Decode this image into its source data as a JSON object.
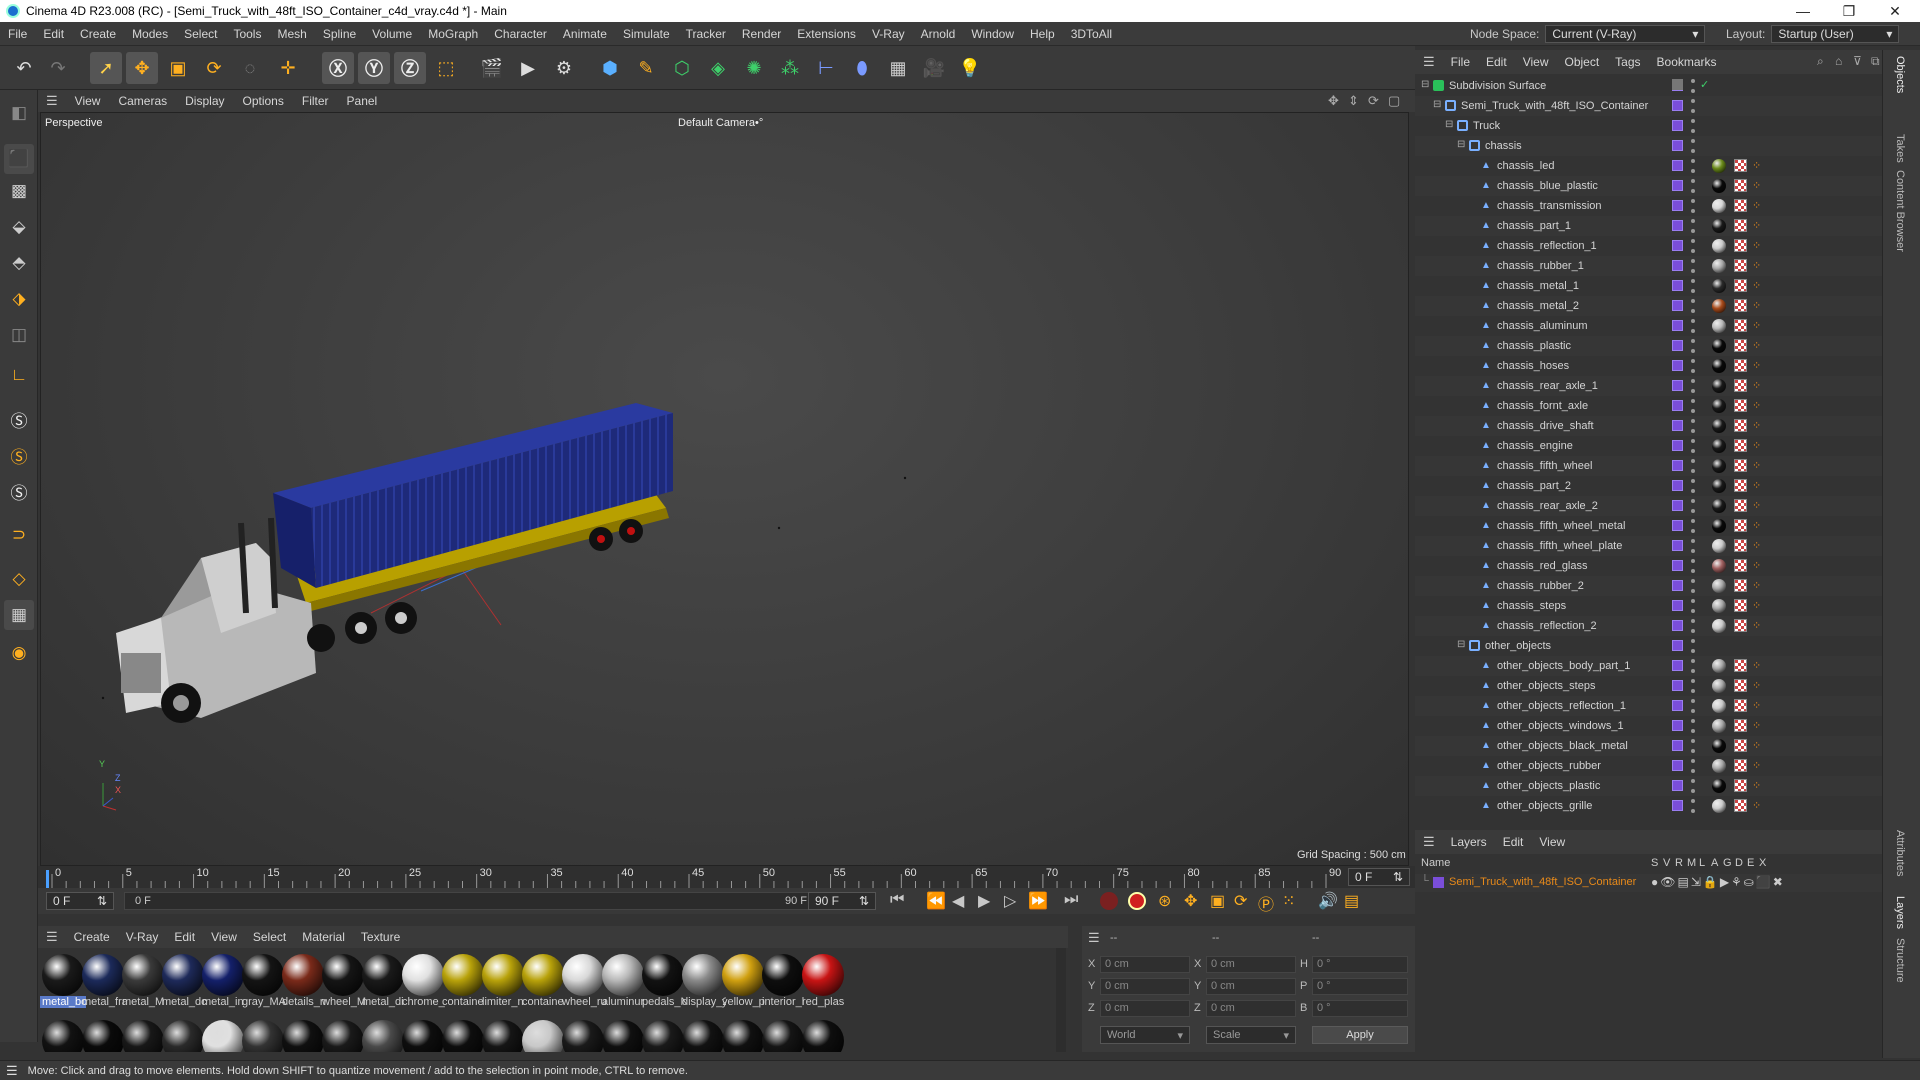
{
  "window": {
    "title": "Cinema 4D R23.008 (RC) - [Semi_Truck_with_48ft_ISO_Container_c4d_vray.c4d *] - Main",
    "controls": [
      "—",
      "❐",
      "✕"
    ]
  },
  "menubar": {
    "items": [
      "File",
      "Edit",
      "Create",
      "Modes",
      "Select",
      "Tools",
      "Mesh",
      "Spline",
      "Volume",
      "MoGraph",
      "Character",
      "Animate",
      "Simulate",
      "Tracker",
      "Render",
      "Extensions",
      "V-Ray",
      "Arnold",
      "Window",
      "Help",
      "3DToAll"
    ],
    "node_space_label": "Node Space:",
    "node_space_value": "Current (V-Ray)",
    "layout_label": "Layout:",
    "layout_value": "Startup (User)"
  },
  "viewport": {
    "menu": [
      "View",
      "Cameras",
      "Display",
      "Options",
      "Filter",
      "Panel"
    ],
    "label": "Perspective",
    "camera": "Default Camera",
    "camera_icon": "•°",
    "grid_spacing": "Grid Spacing : 500 cm",
    "axis_y": "Y",
    "axis_z": "Z",
    "axis_x": "X"
  },
  "timeline": {
    "ticks": [
      "0",
      "5",
      "10",
      "15",
      "20",
      "25",
      "30",
      "35",
      "40",
      "45",
      "50",
      "55",
      "60",
      "65",
      "70",
      "75",
      "80",
      "85",
      "90"
    ],
    "current_frame": "0 F",
    "start_field": "0 F",
    "range_start": "0 F",
    "range_end": "90 F",
    "end_field": "90 F"
  },
  "materials": {
    "menu": [
      "Create",
      "V-Ray",
      "Edit",
      "View",
      "Select",
      "Material",
      "Texture"
    ],
    "row1": [
      {
        "label": "metal_bo",
        "color": "#1a1a1a"
      },
      {
        "label": "metal_fra",
        "color": "#1c2a5a"
      },
      {
        "label": "metal_M",
        "color": "#3a3a3a"
      },
      {
        "label": "metal_dc",
        "color": "#1e2a5a"
      },
      {
        "label": "metal_in",
        "color": "#14206a"
      },
      {
        "label": "gray_MA",
        "color": "#141414"
      },
      {
        "label": "details_n",
        "color": "#7a2a1a"
      },
      {
        "label": "wheel_M",
        "color": "#151515"
      },
      {
        "label": "metal_di",
        "color": "#1a1a1a"
      },
      {
        "label": "chrome_",
        "color": "#e0e0e0"
      },
      {
        "label": "containe",
        "color": "#b8a20a"
      },
      {
        "label": "limiter_n",
        "color": "#b8a20a"
      },
      {
        "label": "containe",
        "color": "#b8a20a"
      },
      {
        "label": "wheel_ru",
        "color": "#d8d8d8"
      },
      {
        "label": "aluminur",
        "color": "#b8b8b8"
      },
      {
        "label": "pedals_N",
        "color": "#121212"
      },
      {
        "label": "display_2",
        "color": "#8a8a8a"
      },
      {
        "label": "yellow_p",
        "color": "#d0a010"
      },
      {
        "label": "interior_l",
        "color": "#0e0e0e"
      },
      {
        "label": "red_plas",
        "color": "#c81414"
      }
    ],
    "row2": [
      "#121212",
      "#0a0a0a",
      "#181818",
      "#2a2a2a",
      "#e0e0e0",
      "#333333",
      "#101010",
      "#1a1a1a",
      "#4a4a4a",
      "#0e0e0e",
      "#0e0e0e",
      "#151515",
      "#c8c8c8",
      "#1a1a1a",
      "#101010",
      "#1a1a1a",
      "#121212",
      "#101010",
      "#151515",
      "#0e0e0e"
    ]
  },
  "coords": {
    "header": [
      "--",
      "--",
      "--"
    ],
    "rows": [
      {
        "a": "X",
        "av": "0 cm",
        "b": "X",
        "bv": "0 cm",
        "c": "H",
        "cv": "0 °"
      },
      {
        "a": "Y",
        "av": "0 cm",
        "b": "Y",
        "bv": "0 cm",
        "c": "P",
        "cv": "0 °"
      },
      {
        "a": "Z",
        "av": "0 cm",
        "b": "Z",
        "bv": "0 cm",
        "c": "B",
        "cv": "0 °"
      }
    ],
    "space": "World",
    "mode": "Scale",
    "apply": "Apply"
  },
  "objects": {
    "menu": [
      "File",
      "Edit",
      "View",
      "Object",
      "Tags",
      "Bookmarks"
    ],
    "tree": [
      {
        "name": "Subdivision Surface",
        "indent": 0,
        "kind": "subdiv",
        "tag": "none"
      },
      {
        "name": "Semi_Truck_with_48ft_ISO_Container",
        "indent": 1,
        "kind": "null",
        "tag": "none"
      },
      {
        "name": "Truck",
        "indent": 2,
        "kind": "null",
        "tag": "none"
      },
      {
        "name": "chassis",
        "indent": 3,
        "kind": "null",
        "tag": "none"
      },
      {
        "name": "chassis_led",
        "indent": 4,
        "kind": "poly",
        "tag": "#6a8a1a"
      },
      {
        "name": "chassis_blue_plastic",
        "indent": 4,
        "kind": "poly",
        "tag": "#0a0a0a"
      },
      {
        "name": "chassis_transmission",
        "indent": 4,
        "kind": "poly",
        "tag": "#d8d8d8"
      },
      {
        "name": "chassis_part_1",
        "indent": 4,
        "kind": "poly",
        "tag": "#1a1a1a"
      },
      {
        "name": "chassis_reflection_1",
        "indent": 4,
        "kind": "poly",
        "tag": "#cccccc"
      },
      {
        "name": "chassis_rubber_1",
        "indent": 4,
        "kind": "poly",
        "tag": "#aaaaaa"
      },
      {
        "name": "chassis_metal_1",
        "indent": 4,
        "kind": "poly",
        "tag": "#2a2a2a"
      },
      {
        "name": "chassis_metal_2",
        "indent": 4,
        "kind": "poly",
        "tag": "#a84a1a"
      },
      {
        "name": "chassis_aluminum",
        "indent": 4,
        "kind": "poly",
        "tag": "#bbbbbb"
      },
      {
        "name": "chassis_plastic",
        "indent": 4,
        "kind": "poly",
        "tag": "#0a0a0a"
      },
      {
        "name": "chassis_hoses",
        "indent": 4,
        "kind": "poly",
        "tag": "#0a0a0a"
      },
      {
        "name": "chassis_rear_axle_1",
        "indent": 4,
        "kind": "poly",
        "tag": "#1a1a1a"
      },
      {
        "name": "chassis_fornt_axle",
        "indent": 4,
        "kind": "poly",
        "tag": "#1a1a1a"
      },
      {
        "name": "chassis_drive_shaft",
        "indent": 4,
        "kind": "poly",
        "tag": "#1a1a1a"
      },
      {
        "name": "chassis_engine",
        "indent": 4,
        "kind": "poly",
        "tag": "#1a1a1a"
      },
      {
        "name": "chassis_fifth_wheel",
        "indent": 4,
        "kind": "poly",
        "tag": "#1a1a1a"
      },
      {
        "name": "chassis_part_2",
        "indent": 4,
        "kind": "poly",
        "tag": "#1a1a1a"
      },
      {
        "name": "chassis_rear_axle_2",
        "indent": 4,
        "kind": "poly",
        "tag": "#1a1a1a"
      },
      {
        "name": "chassis_fifth_wheel_metal",
        "indent": 4,
        "kind": "poly",
        "tag": "#0a0a0a"
      },
      {
        "name": "chassis_fifth_wheel_plate",
        "indent": 4,
        "kind": "poly",
        "tag": "#cccccc"
      },
      {
        "name": "chassis_red_glass",
        "indent": 4,
        "kind": "poly",
        "tag": "#a06060"
      },
      {
        "name": "chassis_rubber_2",
        "indent": 4,
        "kind": "poly",
        "tag": "#aaaaaa"
      },
      {
        "name": "chassis_steps",
        "indent": 4,
        "kind": "poly",
        "tag": "#aaaaaa"
      },
      {
        "name": "chassis_reflection_2",
        "indent": 4,
        "kind": "poly",
        "tag": "#cccccc"
      },
      {
        "name": "other_objects",
        "indent": 3,
        "kind": "null",
        "tag": "none"
      },
      {
        "name": "other_objects_body_part_1",
        "indent": 4,
        "kind": "poly",
        "tag": "#aaaaaa"
      },
      {
        "name": "other_objects_steps",
        "indent": 4,
        "kind": "poly",
        "tag": "#aaaaaa"
      },
      {
        "name": "other_objects_reflection_1",
        "indent": 4,
        "kind": "poly",
        "tag": "#cccccc"
      },
      {
        "name": "other_objects_windows_1",
        "indent": 4,
        "kind": "poly",
        "tag": "#aaaaaa"
      },
      {
        "name": "other_objects_black_metal",
        "indent": 4,
        "kind": "poly",
        "tag": "#0a0a0a"
      },
      {
        "name": "other_objects_rubber",
        "indent": 4,
        "kind": "poly",
        "tag": "#aaaaaa"
      },
      {
        "name": "other_objects_plastic",
        "indent": 4,
        "kind": "poly",
        "tag": "#0a0a0a"
      },
      {
        "name": "other_objects_grille",
        "indent": 4,
        "kind": "poly",
        "tag": "#cccccc"
      }
    ]
  },
  "layers": {
    "menu": [
      "Layers",
      "Edit",
      "View"
    ],
    "name_header": "Name",
    "flags": [
      "S",
      "V",
      "R",
      "M",
      "L",
      "A",
      "G",
      "D",
      "E",
      "X"
    ],
    "layer_name": "Semi_Truck_with_48ft_ISO_Container"
  },
  "right_tabs": [
    "Objects",
    "Takes",
    "Content Browser",
    "Attributes",
    "Layers",
    "Structure"
  ],
  "status": "Move: Click and drag to move elements. Hold down SHIFT to quantize movement / add to the selection in point mode, CTRL to remove.",
  "colors": {
    "accent": "#7a4ed9",
    "layer_orange": "#e88a1a",
    "container_blue": "#1e2a7a",
    "trailer_yellow": "#c8b000"
  }
}
